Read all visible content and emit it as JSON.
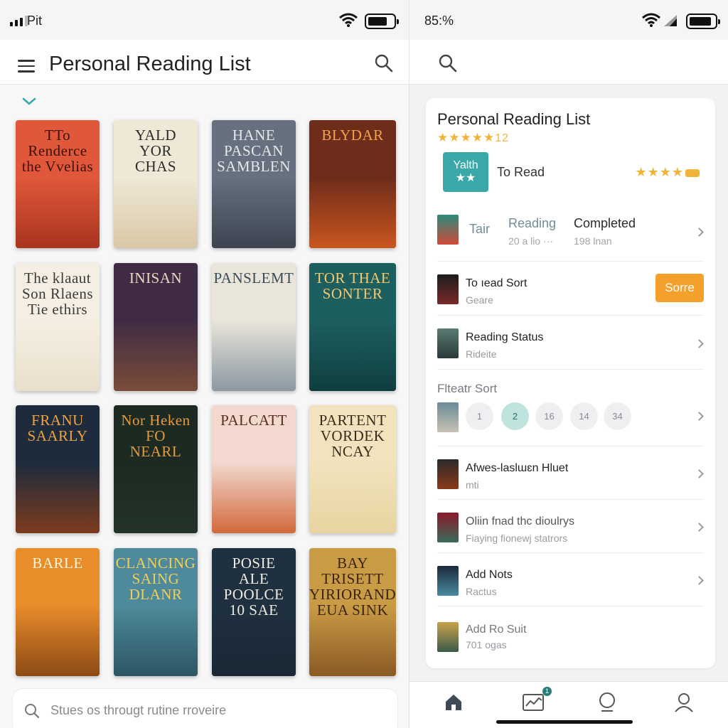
{
  "left": {
    "status": {
      "carrier": "Pit"
    },
    "title": "Personal Reading List",
    "books": [
      {
        "title": "TTo Renderce the Vvelias",
        "bg": "#e0573a",
        "fg": "#3a1208",
        "art": "#a8341f"
      },
      {
        "title": "YALD YOR CHAS",
        "bg": "#efe8d6",
        "fg": "#2a2a2a",
        "art": "#d9c7a6"
      },
      {
        "title": "HANE PASCAN SAMBLEN",
        "bg": "#66707e",
        "fg": "#e8e8ea",
        "art": "#3c4450"
      },
      {
        "title": "BLYDAR",
        "bg": "#6e2c1b",
        "fg": "#f3a24a",
        "art": "#c9561f"
      },
      {
        "title": "The klaaut Son Rlaens Tie ethirs",
        "bg": "#f5efe3",
        "fg": "#3a3a3a",
        "art": "#e9dfcb"
      },
      {
        "title": "INISAN",
        "bg": "#3f2c44",
        "fg": "#e7d9c0",
        "art": "#7a4c3a"
      },
      {
        "title": "PANSLEMT",
        "bg": "#e9e5da",
        "fg": "#3b4b57",
        "art": "#8b98a2"
      },
      {
        "title": "TOR THAE SONTER",
        "bg": "#1d5e5e",
        "fg": "#f2c871",
        "art": "#0f3e40"
      },
      {
        "title": "FRANU SAARLY",
        "bg": "#1d2b3d",
        "fg": "#f0a33b",
        "art": "#7e3b1e"
      },
      {
        "title": "Nor Heken FO NEARL",
        "bg": "#1d2a22",
        "fg": "#e69a3a",
        "art": "#22332a"
      },
      {
        "title": "PALCATT",
        "bg": "#f2d8cf",
        "fg": "#5a2d20",
        "art": "#d2693c"
      },
      {
        "title": "PARTENT VORDEK NCAY",
        "bg": "#f1e3bd",
        "fg": "#3a2c1a",
        "art": "#e7d4a0"
      },
      {
        "title": "BARLE",
        "bg": "#e98c2a",
        "fg": "#fff4dc",
        "art": "#8c4a14"
      },
      {
        "title": "CLANCING SAING DLANR",
        "bg": "#4e8a9b",
        "fg": "#f0cf5a",
        "art": "#2c5563"
      },
      {
        "title": "POSIE ALE POOLCE 10 SAE",
        "bg": "#1f3040",
        "fg": "#f0ece2",
        "art": "#1a2835"
      },
      {
        "title": "BAY TRISETT YIRIORAND EUA SINK",
        "bg": "#c99b45",
        "fg": "#3a2410",
        "art": "#8a5a24"
      }
    ],
    "search_placeholder": "Stues os througt rutine rroveire"
  },
  "right": {
    "status": {
      "text": "85:%"
    },
    "card": {
      "title": "Personal Reading List",
      "stars": "★★★★★",
      "rating_count": "12",
      "tile_text": "Yalth",
      "tile_stars": "★★",
      "to_read": "To Read",
      "to_read_stars": "★★★★",
      "tabs": {
        "tair": "Tair",
        "reading": "Reading",
        "reading_sub": "20 a lio ···",
        "completed": "Completed",
        "completed_sub": "198 lnan"
      },
      "rows": {
        "to_read_sort": {
          "title": "To ıead Sort",
          "sub": "Geare",
          "button": "Sorre"
        },
        "reading_status": {
          "title": "Reading Status",
          "sub": "Rideite"
        },
        "filter_sort": {
          "title": "Flteatr Sort",
          "chips": [
            "1",
            "2",
            "16",
            "14",
            "34"
          ]
        },
        "alwes": {
          "title": "Afwes-laslɯɛn Hluet",
          "sub": "mti"
        },
        "oliin": {
          "title": "Oliin fnad thc dioulrys",
          "sub": "Fiaying fionewj statrors"
        },
        "add_nots": {
          "title": "Add Nots",
          "sub": "Ractus"
        },
        "add_ro": {
          "title": "Add Ro Suit",
          "sub": "701 ogas"
        }
      }
    },
    "tabbar": {
      "badge": "1"
    }
  }
}
